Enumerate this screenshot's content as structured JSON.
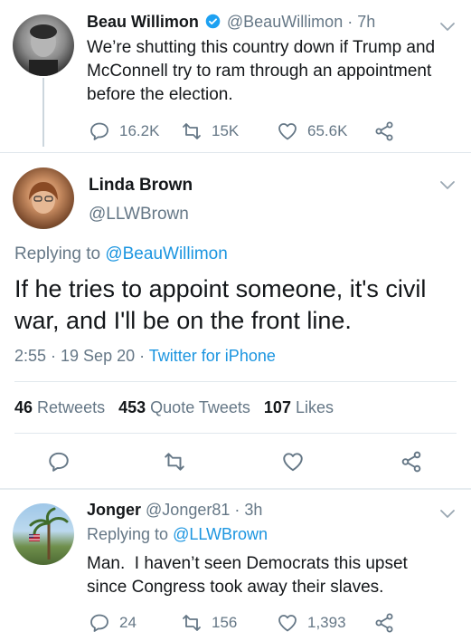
{
  "tweet1": {
    "name": "Beau Willimon",
    "handle": "@BeauWillimon",
    "time": "· 7h",
    "text": "We’re shutting this country down if Trump and McConnell try to ram through an appointment before the election.",
    "replies": "16.2K",
    "retweets": "15K",
    "likes": "65.6K"
  },
  "main_tweet": {
    "name": "Linda Brown",
    "handle": "@LLWBrown",
    "replying_prefix": "Replying to",
    "replying_to": "@BeauWillimon",
    "text": "If he tries to appoint someone, it's civil war, and I'll be on the front line.",
    "time": "2:55 · 19 Sep 20 ·",
    "source": "Twitter for iPhone",
    "retweets_count": "46",
    "retweets_label": "Retweets",
    "quote_count": "453",
    "quote_label": "Quote Tweets",
    "likes_count": "107",
    "likes_label": "Likes"
  },
  "reply": {
    "name": "Jonger",
    "handle": "@Jonger81",
    "time": "· 3h",
    "replying_prefix": "Replying to",
    "replying_to": "@LLWBrown",
    "text": "Man.  I haven’t seen Democrats this upset since Congress took away their slaves.",
    "replies": "24",
    "retweets": "156",
    "likes": "1,393"
  },
  "colors": {
    "link": "#1b95e0",
    "muted": "#657786",
    "verified": "#1da1f2"
  },
  "icons": [
    "reply-icon",
    "retweet-icon",
    "like-icon",
    "share-icon",
    "chevron-down-icon",
    "verified-badge-icon"
  ]
}
